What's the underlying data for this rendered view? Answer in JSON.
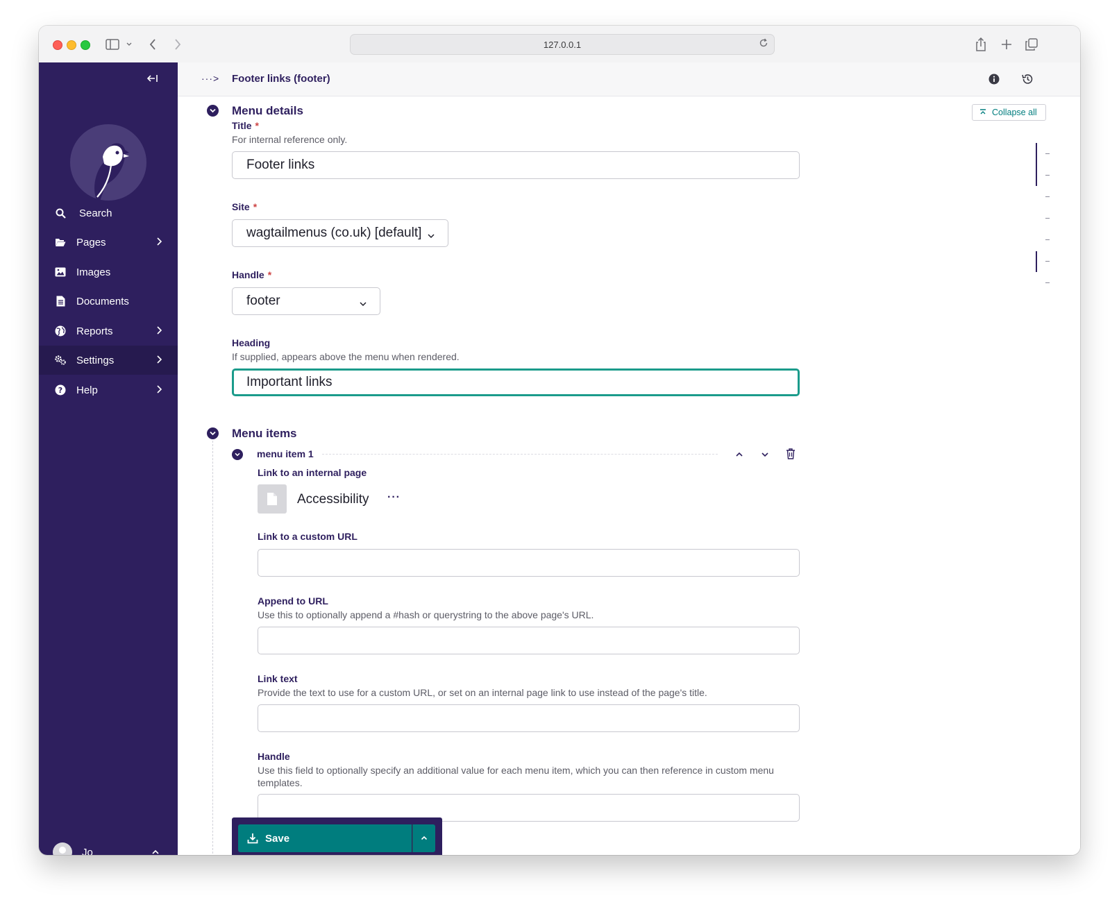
{
  "browser": {
    "url": "127.0.0.1"
  },
  "sidebar": {
    "items": [
      {
        "label": "Search",
        "icon": "search-icon"
      },
      {
        "label": "Pages",
        "icon": "folder-open-icon"
      },
      {
        "label": "Images",
        "icon": "image-icon"
      },
      {
        "label": "Documents",
        "icon": "document-icon"
      },
      {
        "label": "Reports",
        "icon": "globe-icon"
      },
      {
        "label": "Settings",
        "icon": "cogs-icon"
      },
      {
        "label": "Help",
        "icon": "help-icon"
      }
    ],
    "user": "Jo"
  },
  "header": {
    "breadcrumb": "···>",
    "title": "Footer links (footer)"
  },
  "toolbar": {
    "collapse_all": "Collapse all"
  },
  "menu_details": {
    "heading": "Menu details",
    "title_label": "Title",
    "title_help": "For internal reference only.",
    "title_value": "Footer links",
    "site_label": "Site",
    "site_value": "wagtailmenus (co.uk) [default]",
    "handle_label": "Handle",
    "handle_value": "footer",
    "heading_label": "Heading",
    "heading_help": "If supplied, appears above the menu when rendered.",
    "heading_value": "Important links",
    "required_mark": "*"
  },
  "menu_items": {
    "heading": "Menu items",
    "item_title": "menu item 1",
    "link_page_label": "Link to an internal page",
    "linked_page": "Accessibility",
    "more": "···",
    "custom_url_label": "Link to a custom URL",
    "custom_url_value": "",
    "append_label": "Append to URL",
    "append_help": "Use this to optionally append a #hash or querystring to the above page's URL.",
    "append_value": "",
    "link_text_label": "Link text",
    "link_text_help": "Provide the text to use for a custom URL, or set on an internal page link to use instead of the page's title.",
    "link_text_value": "",
    "handle_label": "Handle",
    "handle_help": "Use this field to optionally specify an additional value for each menu item, which you can then reference in custom menu templates.",
    "handle_value": ""
  },
  "actions": {
    "save": "Save"
  },
  "colors": {
    "sidebar": "#2e1f5e",
    "primary": "#007d7e",
    "focus": "#1b9b8b",
    "required": "#cd4444"
  }
}
